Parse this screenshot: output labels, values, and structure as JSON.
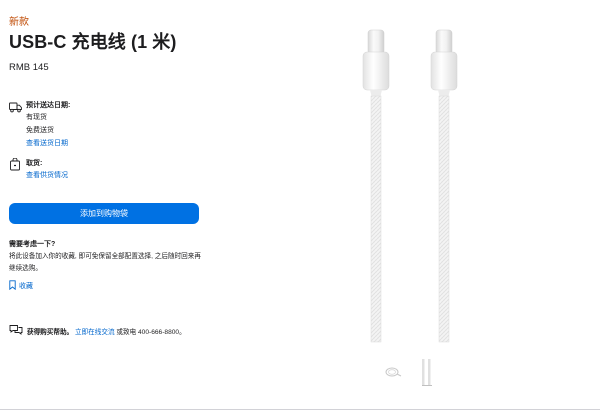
{
  "product": {
    "badge": "新款",
    "title": "USB-C 充电线 (1 米)",
    "price": "RMB 145"
  },
  "delivery": {
    "icon": "truck-icon",
    "title": "预计送达日期:",
    "line1": "有现货",
    "line2": "免费送货",
    "link": "查看送货日期"
  },
  "pickup": {
    "icon": "store-icon",
    "title": "取货:",
    "link": "查看供货情况"
  },
  "cart": {
    "label": "添加到购物袋"
  },
  "consider": {
    "question": "需要考虑一下?",
    "description": "将此设备加入你的收藏, 即可免保留全部配置选择, 之后随时回来再继续选购。"
  },
  "favorite": {
    "icon": "bookmark-icon",
    "label": "收藏"
  },
  "help": {
    "icon": "chat-icon",
    "prefix": "获得购买帮助。",
    "link": "立即在线交流",
    "suffix": "或致电 400-666-8800。"
  },
  "colors": {
    "accent": "#0071e3",
    "link": "#0066cc",
    "badge": "#bf4800"
  }
}
